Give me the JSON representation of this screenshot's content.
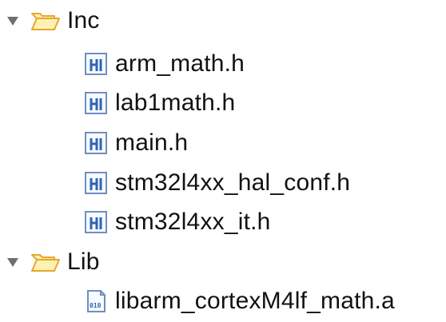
{
  "tree": {
    "inc_folder": {
      "label": "Inc",
      "expanded": true,
      "toggle_icon": "triangle-down-icon",
      "folder_icon": "open-folder-icon",
      "files": [
        {
          "label": "arm_math.h",
          "icon": "header-file-icon"
        },
        {
          "label": "lab1math.h",
          "icon": "header-file-icon"
        },
        {
          "label": "main.h",
          "icon": "header-file-icon"
        },
        {
          "label": "stm32l4xx_hal_conf.h",
          "icon": "header-file-icon"
        },
        {
          "label": "stm32l4xx_it.h",
          "icon": "header-file-icon"
        }
      ]
    },
    "lib_folder": {
      "label": "Lib",
      "expanded": true,
      "toggle_icon": "triangle-down-icon",
      "folder_icon": "open-folder-icon",
      "files": [
        {
          "label": "libarm_cortexM4lf_math.a",
          "icon": "binary-file-icon"
        }
      ]
    }
  },
  "colors": {
    "triangle": "#6f6f6f",
    "folder_fill": "#fff1b3",
    "folder_stroke": "#e4a82c",
    "file_stroke": "#6f8fbf",
    "file_fill": "#f6fbff",
    "header_glyph": "#2f63b4",
    "binary_glyph": "#2f63b4"
  }
}
